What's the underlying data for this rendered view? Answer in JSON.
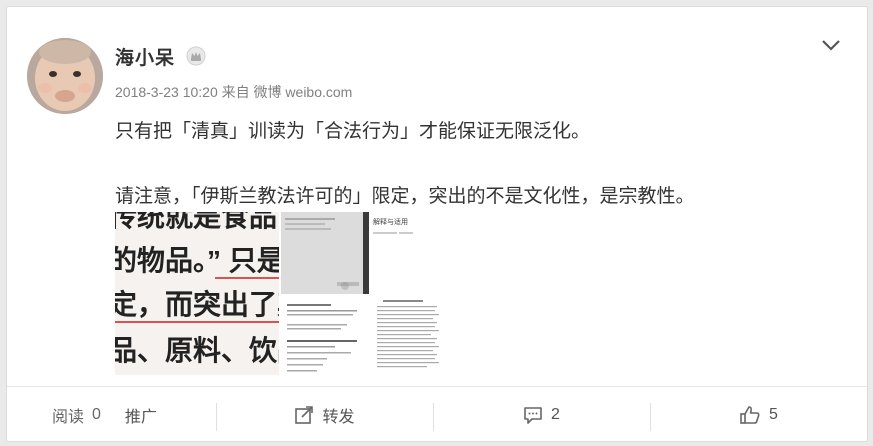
{
  "post": {
    "author": {
      "name": "海小呆",
      "badge_icon": "crown-badge-icon"
    },
    "meta": "2018-3-23 10:20 来自 微博 weibo.com",
    "text_lines": [
      "只有把「清真」训读为「合法行为」才能保证无限泛化。",
      "请注意，「伊斯兰教法许可的」限定，突出的不是文化性，是宗教性。"
    ],
    "images": {
      "first_snippet_lines": [
        "传统就是食品",
        "的物品。” 只是",
        "定，而突出了其",
        "品、原料、饮品"
      ],
      "book_cover_text": "解释与适用"
    }
  },
  "actions": {
    "read_label": "阅读",
    "read_count": "0",
    "promote_label": "推广",
    "repost_label": "转发",
    "comment_count": "2",
    "like_count": "5"
  },
  "colors": {
    "text": "#333333",
    "meta": "#808080",
    "action": "#555555",
    "underline_red": "#d9534f"
  }
}
